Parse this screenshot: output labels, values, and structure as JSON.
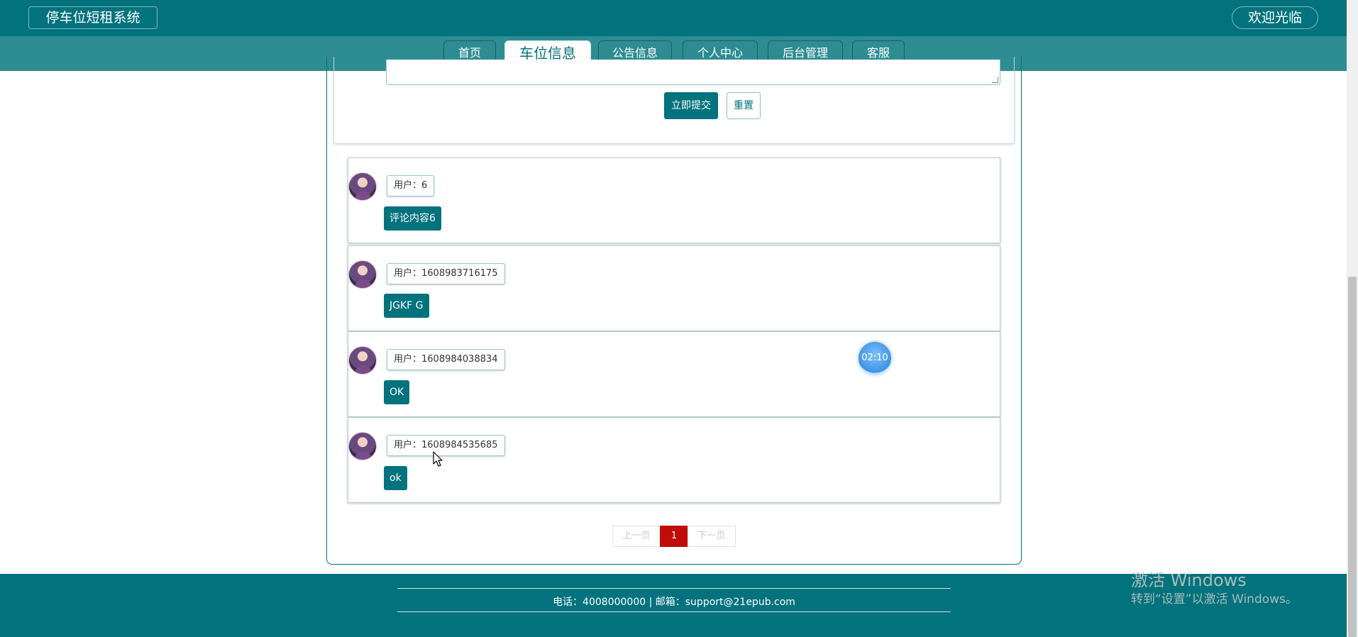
{
  "header": {
    "site_title": "停车位短租系统",
    "welcome": "欢迎光临"
  },
  "nav": {
    "items": [
      {
        "label": "首页",
        "active": false
      },
      {
        "label": "车位信息",
        "active": true
      },
      {
        "label": "公告信息",
        "active": false
      },
      {
        "label": "个人中心",
        "active": false
      },
      {
        "label": "后台管理",
        "active": false
      },
      {
        "label": "客服",
        "active": false
      }
    ]
  },
  "form": {
    "submit_label": "立即提交",
    "reset_label": "重置"
  },
  "comments": [
    {
      "user": "用户：6",
      "content": "评论内容6"
    },
    {
      "user": "用户：1608983716175",
      "content": "JGKF G"
    },
    {
      "user": "用户：1608984038834",
      "content": "OK"
    },
    {
      "user": "用户：1608984535685",
      "content": "ok"
    }
  ],
  "pagination": {
    "prev": "上一页",
    "current": "1",
    "next": "下一页"
  },
  "timer": "02:10",
  "footer": {
    "contact": "电话：4008000000 | 邮箱：support@21epub.com"
  },
  "watermark": {
    "line1": "激活 Windows",
    "line2": "转到“设置”以激活 Windows。"
  },
  "colors": {
    "primary": "#02727c",
    "nav_bg": "#2d8d93",
    "page_current": "#c20c0c"
  }
}
